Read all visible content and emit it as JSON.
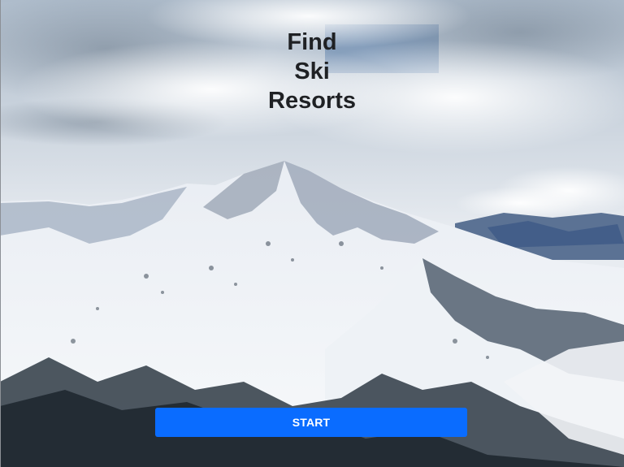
{
  "hero": {
    "title_lines": [
      "Find",
      "Ski",
      "Resorts"
    ],
    "background": "snowy-mountain-photo"
  },
  "actions": {
    "start_label": "START"
  },
  "colors": {
    "button": "#0a6cff",
    "button_text": "#ffffff",
    "title_text": "#1f2124"
  }
}
